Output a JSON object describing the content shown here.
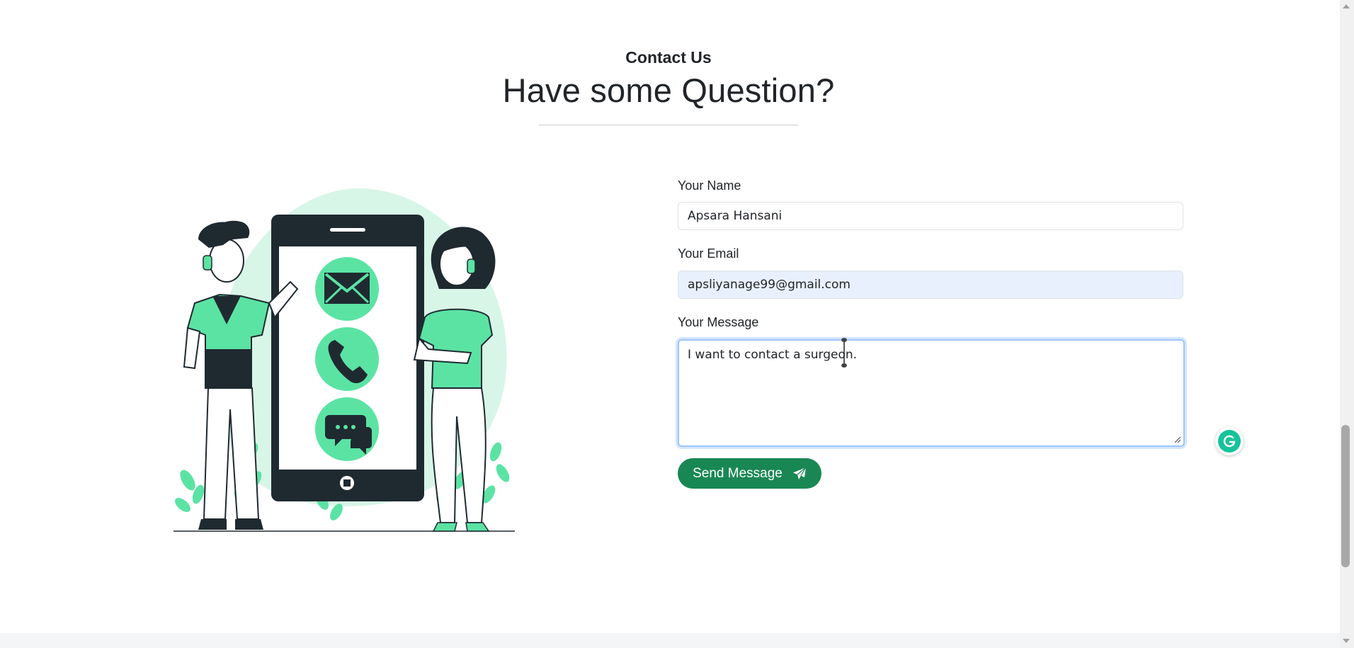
{
  "section": {
    "kicker": "Contact Us",
    "title_light": "Have some ",
    "title_bold": "Question?"
  },
  "form": {
    "name_label": "Your Name",
    "name_value": "Apsara Hansani",
    "email_label": "Your Email",
    "email_value": "apsliyanage99@gmail.com",
    "message_label": "Your Message",
    "message_value": "I want to contact a surgeon.",
    "send_label": "Send Message"
  },
  "icons": {
    "send": "paper-plane-icon",
    "grammarly": "grammarly-icon",
    "illustration": "contact-phone-illustration"
  },
  "colors": {
    "accent_green": "#198754",
    "mint": "#5be3a4",
    "mint_light": "#d8f6e8",
    "dark": "#1f2a30",
    "focus_border": "#9ec5fe",
    "autofill_bg": "#e8f0fe"
  }
}
